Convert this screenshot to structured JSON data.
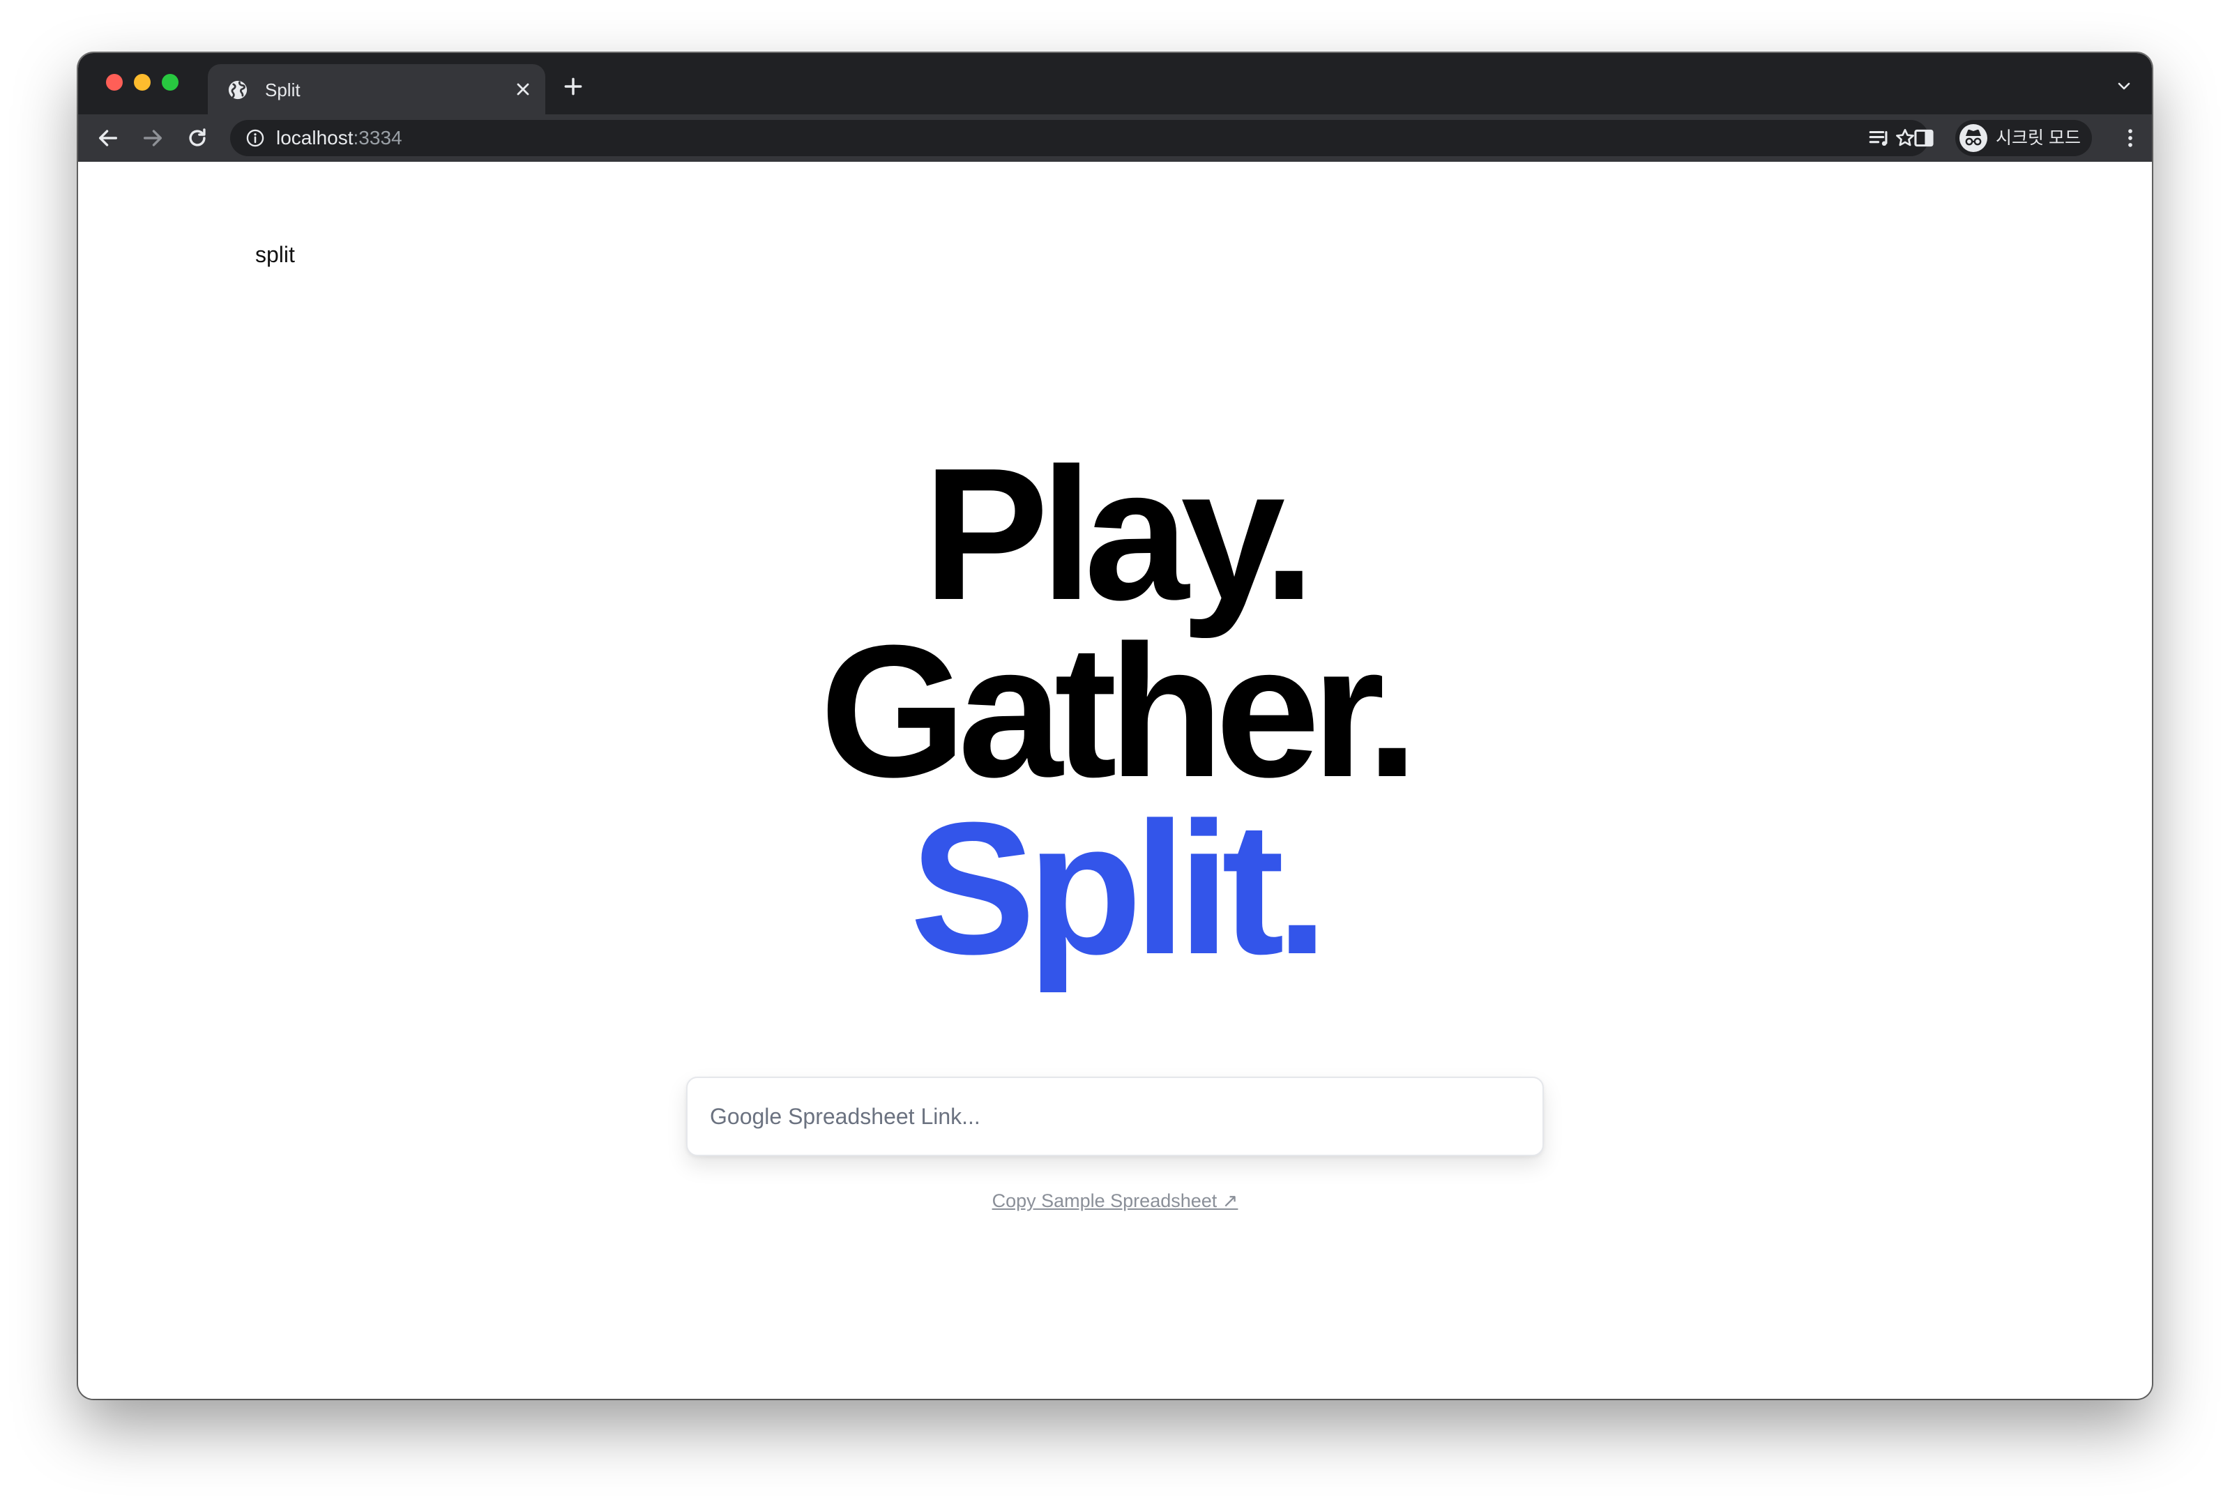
{
  "browser": {
    "tab_title": "Split",
    "url_host": "localhost",
    "url_port": ":3334",
    "profile_label": "시크릿 모드"
  },
  "page": {
    "brand": "split",
    "headline": [
      "Play.",
      "Gather.",
      "Split."
    ],
    "search": {
      "placeholder": "Google Spreadsheet Link...",
      "value": ""
    },
    "sample_link": "Copy Sample Spreadsheet ↗"
  },
  "colors": {
    "accent": "#3355ea",
    "headline": "#000000",
    "browser_frame": "#202124",
    "browser_toolbar": "#35363a"
  },
  "icons": [
    "globe-icon",
    "close-icon",
    "plus-icon",
    "chevron-down-icon",
    "back-arrow-icon",
    "forward-arrow-icon",
    "reload-icon",
    "info-icon",
    "star-icon",
    "reading-list-icon",
    "side-panel-icon",
    "incognito-icon",
    "more-vert-icon"
  ]
}
